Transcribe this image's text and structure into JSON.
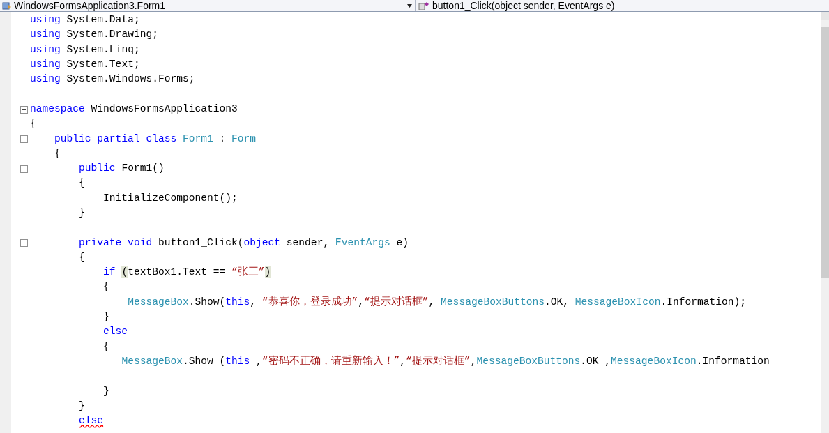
{
  "navigation_bar": {
    "type_dropdown": "WindowsFormsApplication3.Form1",
    "member_dropdown": "button1_Click(object sender, EventArgs e)"
  },
  "code_lines": [
    {
      "tokens": [
        {
          "text": "using",
          "kind": "keyword"
        },
        {
          "text": " System.Data;",
          "kind": "plain"
        }
      ]
    },
    {
      "tokens": [
        {
          "text": "using",
          "kind": "keyword"
        },
        {
          "text": " System.Drawing;",
          "kind": "plain"
        }
      ]
    },
    {
      "tokens": [
        {
          "text": "using",
          "kind": "keyword"
        },
        {
          "text": " System.Linq;",
          "kind": "plain"
        }
      ]
    },
    {
      "tokens": [
        {
          "text": "using",
          "kind": "keyword"
        },
        {
          "text": " System.Text;",
          "kind": "plain"
        }
      ]
    },
    {
      "tokens": [
        {
          "text": "using",
          "kind": "keyword"
        },
        {
          "text": " System.Windows.Forms;",
          "kind": "plain"
        }
      ]
    },
    {
      "kind": "blank"
    },
    {
      "fold": {
        "expanded": true
      },
      "tokens": [
        {
          "text": "namespace",
          "kind": "keyword"
        },
        {
          "text": " WindowsFormsApplication3",
          "kind": "plain"
        }
      ]
    },
    {
      "tokens": [
        {
          "text": "{",
          "kind": "plain"
        }
      ]
    },
    {
      "fold": {
        "expanded": true
      },
      "tokens": [
        {
          "text": "    public partial class",
          "kind": "keyword"
        },
        {
          "text": " Form1",
          "kind": "type"
        },
        {
          "text": " : ",
          "kind": "plain"
        },
        {
          "text": "Form",
          "kind": "type"
        }
      ]
    },
    {
      "tokens": [
        {
          "text": "    {",
          "kind": "plain"
        }
      ]
    },
    {
      "fold": {
        "expanded": true
      },
      "tokens": [
        {
          "text": "        public",
          "kind": "keyword"
        },
        {
          "text": " Form1()",
          "kind": "plain"
        }
      ]
    },
    {
      "tokens": [
        {
          "text": "        {",
          "kind": "plain"
        }
      ]
    },
    {
      "tokens": [
        {
          "text": "            InitializeComponent();",
          "kind": "plain"
        }
      ]
    },
    {
      "tokens": [
        {
          "text": "        }",
          "kind": "plain"
        }
      ]
    },
    {
      "kind": "blank"
    },
    {
      "fold": {
        "expanded": true
      },
      "tokens": [
        {
          "text": "        private void",
          "kind": "keyword"
        },
        {
          "text": " button1_Click(",
          "kind": "plain"
        },
        {
          "text": "object",
          "kind": "keyword"
        },
        {
          "text": " sender, ",
          "kind": "plain"
        },
        {
          "text": "EventArgs",
          "kind": "type"
        },
        {
          "text": " e)",
          "kind": "plain"
        }
      ]
    },
    {
      "tokens": [
        {
          "text": "        {",
          "kind": "plain"
        }
      ]
    },
    {
      "tokens": [
        {
          "text": "            if ",
          "kind": "keyword"
        },
        {
          "text": "(",
          "kind": "plain",
          "brace_match": true
        },
        {
          "text": "textBox1.Text == ",
          "kind": "plain"
        },
        {
          "text": "“张三”",
          "kind": "string"
        },
        {
          "text": ")",
          "kind": "plain",
          "brace_match": true
        }
      ]
    },
    {
      "tokens": [
        {
          "text": "            {",
          "kind": "plain"
        }
      ]
    },
    {
      "tokens": [
        {
          "text": "                MessageBox",
          "kind": "type"
        },
        {
          "text": ".Show(",
          "kind": "plain"
        },
        {
          "text": "this",
          "kind": "keyword"
        },
        {
          "text": ", ",
          "kind": "plain"
        },
        {
          "text": "“恭喜你，登录成功”",
          "kind": "string"
        },
        {
          "text": ",",
          "kind": "plain"
        },
        {
          "text": "“提示对话框”",
          "kind": "string"
        },
        {
          "text": ", ",
          "kind": "plain"
        },
        {
          "text": "MessageBoxButtons",
          "kind": "type"
        },
        {
          "text": ".OK, ",
          "kind": "plain"
        },
        {
          "text": "MessageBoxIcon",
          "kind": "type"
        },
        {
          "text": ".Information);",
          "kind": "plain"
        }
      ]
    },
    {
      "tokens": [
        {
          "text": "            }",
          "kind": "plain"
        }
      ]
    },
    {
      "tokens": [
        {
          "text": "            else",
          "kind": "keyword"
        }
      ]
    },
    {
      "tokens": [
        {
          "text": "            {",
          "kind": "plain"
        }
      ]
    },
    {
      "tokens": [
        {
          "text": "               MessageBox",
          "kind": "type"
        },
        {
          "text": ".Show (",
          "kind": "plain"
        },
        {
          "text": "this",
          "kind": "keyword"
        },
        {
          "text": " ,",
          "kind": "plain"
        },
        {
          "text": "“密码不正确，请重新输入！”",
          "kind": "string"
        },
        {
          "text": ",",
          "kind": "plain"
        },
        {
          "text": "“提示对话框”",
          "kind": "string"
        },
        {
          "text": ",",
          "kind": "plain"
        },
        {
          "text": "MessageBoxButtons",
          "kind": "type"
        },
        {
          "text": ".OK ,",
          "kind": "plain"
        },
        {
          "text": "MessageBoxIcon",
          "kind": "type"
        },
        {
          "text": ".Information",
          "kind": "plain"
        }
      ]
    },
    {
      "kind": "blank"
    },
    {
      "tokens": [
        {
          "text": "            }",
          "kind": "plain"
        }
      ]
    },
    {
      "tokens": [
        {
          "text": "        }",
          "kind": "plain"
        }
      ]
    },
    {
      "tokens": [
        {
          "text": "        else",
          "kind": "keyword",
          "error": true
        }
      ]
    }
  ]
}
